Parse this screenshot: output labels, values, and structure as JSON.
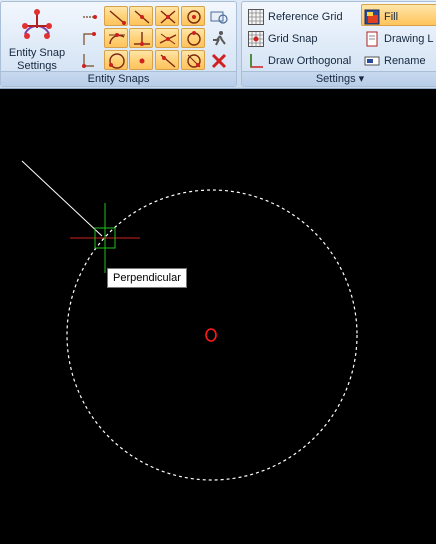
{
  "ribbon": {
    "entity_snaps": {
      "big_button_label": "Entity Snap Settings",
      "group_label": "Entity Snaps",
      "snap_buttons": [
        "endpoint-snap",
        "midpoint-snap",
        "intersection-snap",
        "center-snap",
        "tangent-snap",
        "perpendicular-snap",
        "nearest-snap",
        "quadrant-snap",
        "circle-snap",
        "point-snap",
        "node-snap",
        "extension-snap"
      ]
    },
    "settings": {
      "group_label": "Settings ▾",
      "items": {
        "reference_grid": "Reference Grid",
        "grid_snap": "Grid Snap",
        "draw_orthogonal": "Draw Orthogonal",
        "fill": "Fill",
        "drawing": "Drawing L",
        "rename": "Rename"
      }
    }
  },
  "canvas": {
    "tooltip": "Perpendicular",
    "colors": {
      "background": "#000000",
      "circle": "#ffffff",
      "line": "#ffffff",
      "cursor": "#00c000",
      "center_marker": "#ff0000",
      "crosshair": "#d02020"
    }
  }
}
